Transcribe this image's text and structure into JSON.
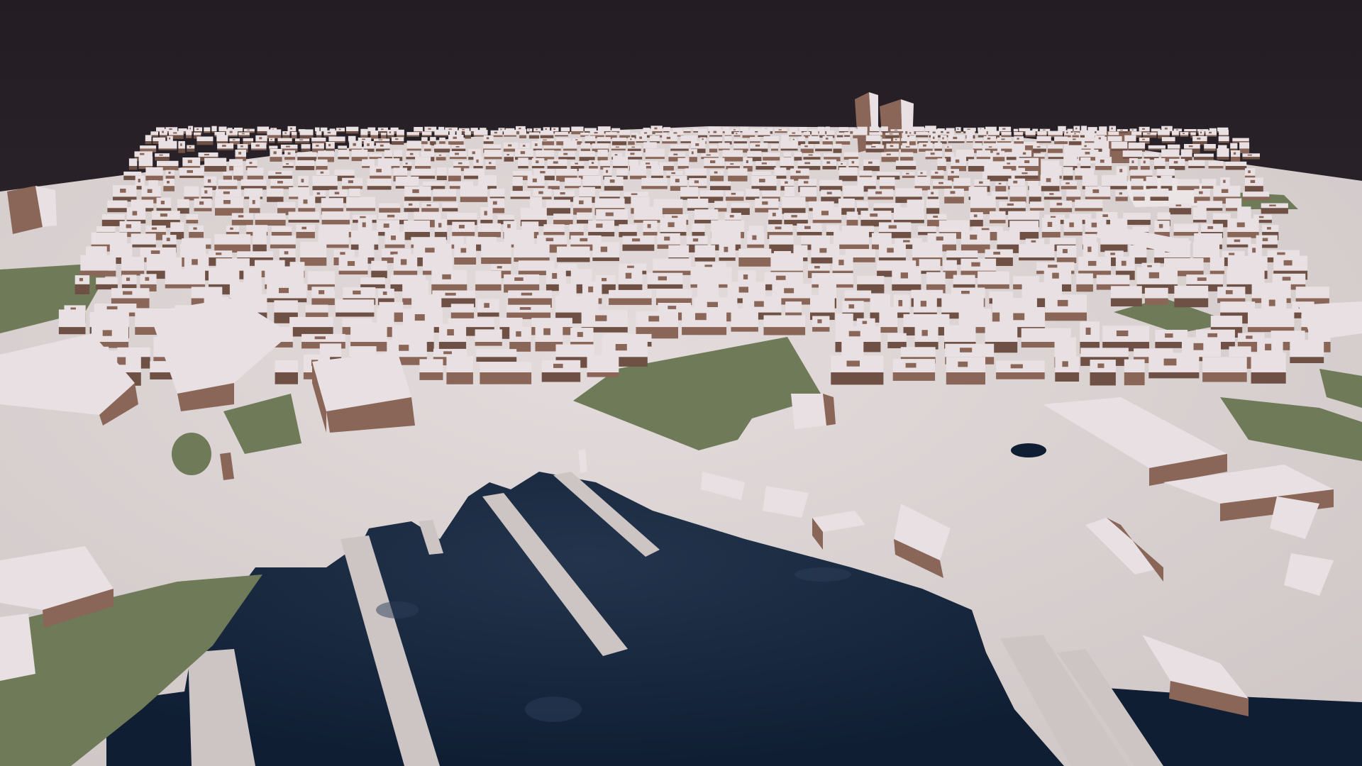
{
  "scene": {
    "subject": "3d-city-model-aerial",
    "colors": {
      "sky_top": "#231d23",
      "sky_bottom": "#3a3139",
      "ground": "#cfc6c6",
      "ground_light": "#e4dcdc",
      "water": "#0f1e33",
      "water_highlight": "#23344c",
      "park": "#6e7a58",
      "building_top": "#e8e0e2",
      "building_side": "#8a6658",
      "building_side_dark": "#6f5045",
      "shadow": "#b8aeae"
    }
  }
}
